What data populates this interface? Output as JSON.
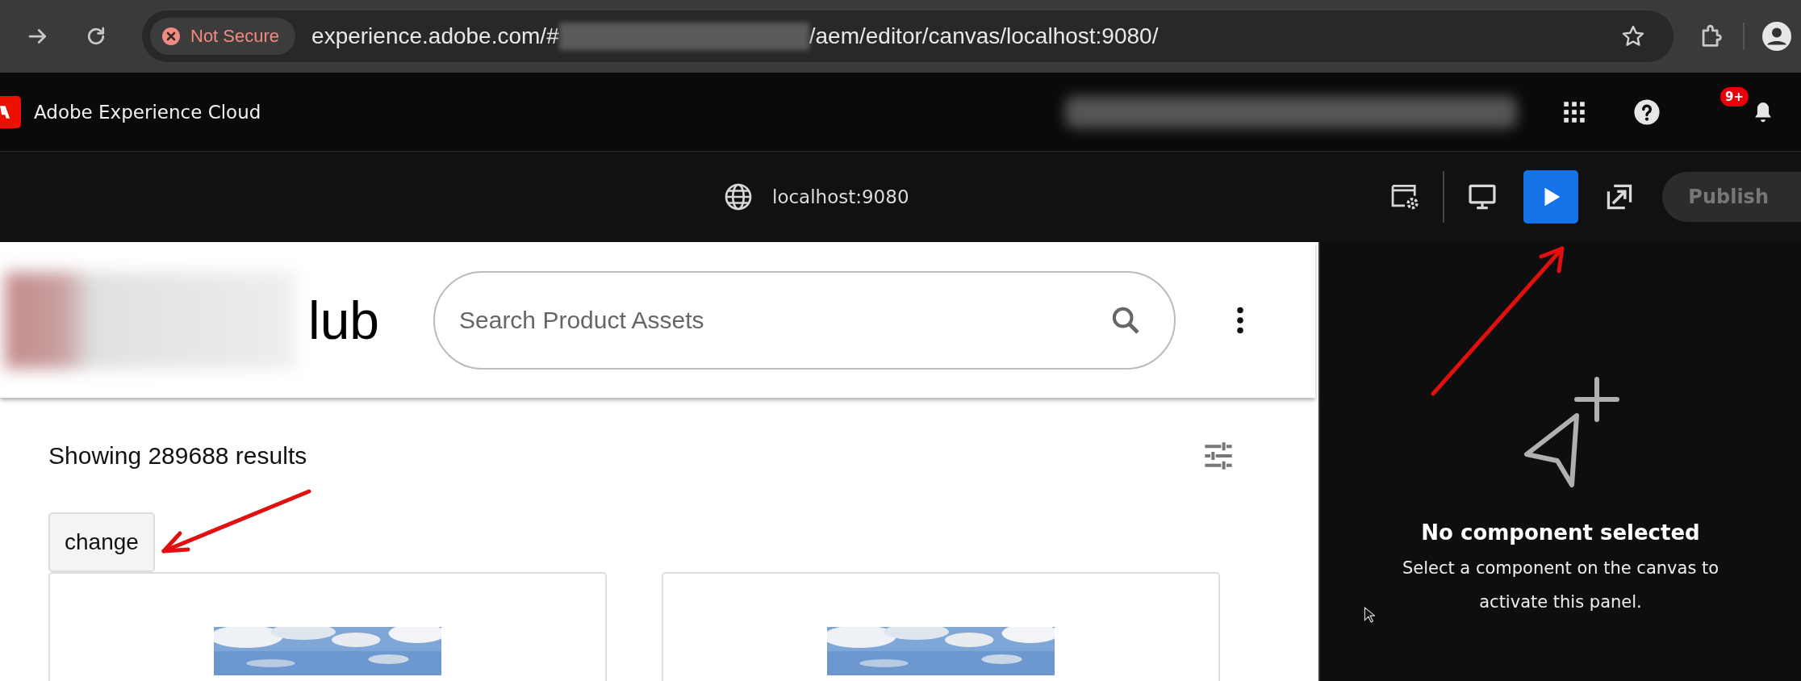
{
  "browser": {
    "security_label": "Not Secure",
    "url_prefix": "experience.adobe.com/#",
    "url_suffix": "/aem/editor/canvas/localhost:9080/"
  },
  "app_header": {
    "title": "Adobe Experience Cloud",
    "notification_badge": "9+"
  },
  "editor_toolbar": {
    "location": "localhost:9080",
    "preview_selected": true,
    "publish_disabled": true,
    "publish_label": "Publish"
  },
  "site": {
    "logo_text": "lub",
    "search": {
      "placeholder": "Search Product Assets"
    },
    "results": "Showing 289688 results",
    "change_button": "change"
  },
  "properties_panel": {
    "title": "No component selected",
    "message": "Select a component on the canvas to activate this panel."
  }
}
